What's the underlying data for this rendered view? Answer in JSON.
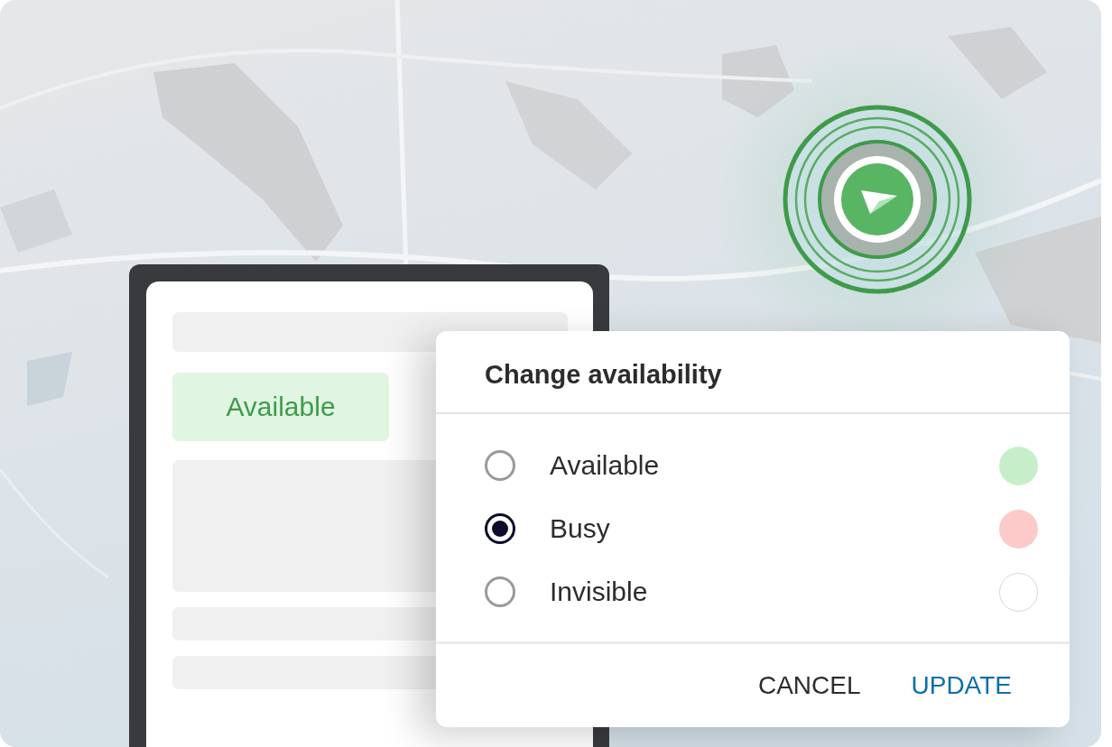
{
  "phone": {
    "status_badge": {
      "label": "Available"
    }
  },
  "dialog": {
    "title": "Change availability",
    "options": [
      {
        "label": "Available",
        "selected": false,
        "color": "#c6efc9"
      },
      {
        "label": "Busy",
        "selected": true,
        "color": "#fdcaca"
      },
      {
        "label": "Invisible",
        "selected": false,
        "color": "#ffffff"
      }
    ],
    "buttons": [
      {
        "label": "CANCEL",
        "kind": "secondary"
      },
      {
        "label": "UPDATE",
        "kind": "primary"
      }
    ]
  }
}
